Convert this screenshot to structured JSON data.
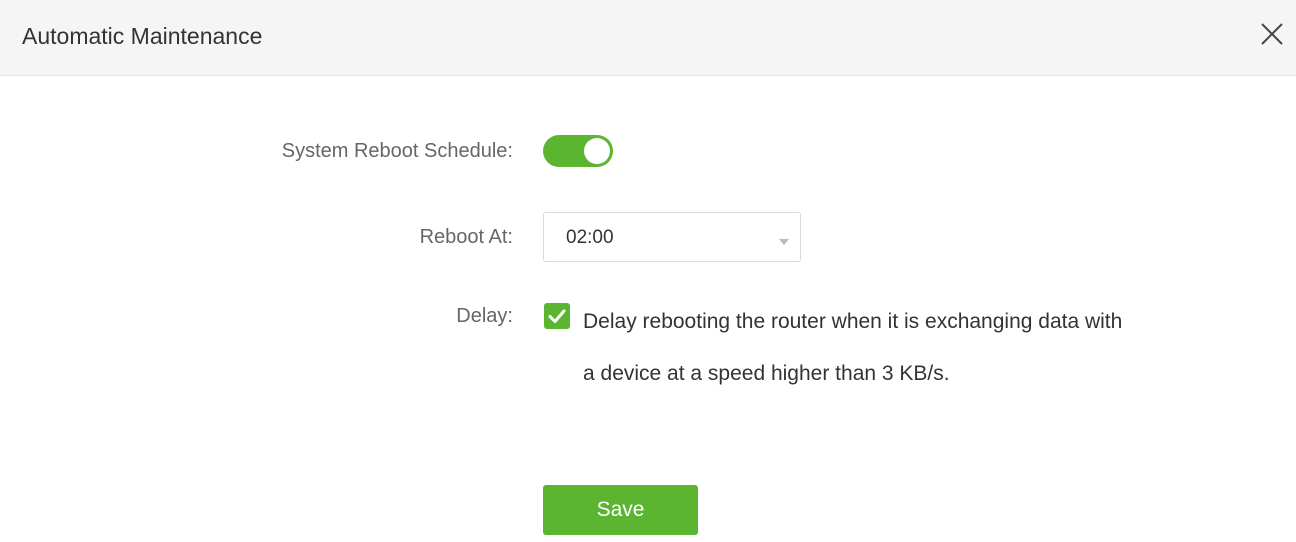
{
  "dialog": {
    "title": "Automatic Maintenance",
    "close_icon": "close-icon"
  },
  "form": {
    "reboot_schedule": {
      "label": "System Reboot Schedule:",
      "enabled": true,
      "on_color": "#5cb531"
    },
    "reboot_at": {
      "label": "Reboot At:",
      "value": "02:00",
      "caret_icon": "chevron-down-icon"
    },
    "delay": {
      "label": "Delay:",
      "checked": true,
      "line1": "Delay rebooting the router when it is exchanging data with",
      "line2": "a device at a speed higher than 3 KB/s."
    }
  },
  "actions": {
    "save_label": "Save"
  }
}
